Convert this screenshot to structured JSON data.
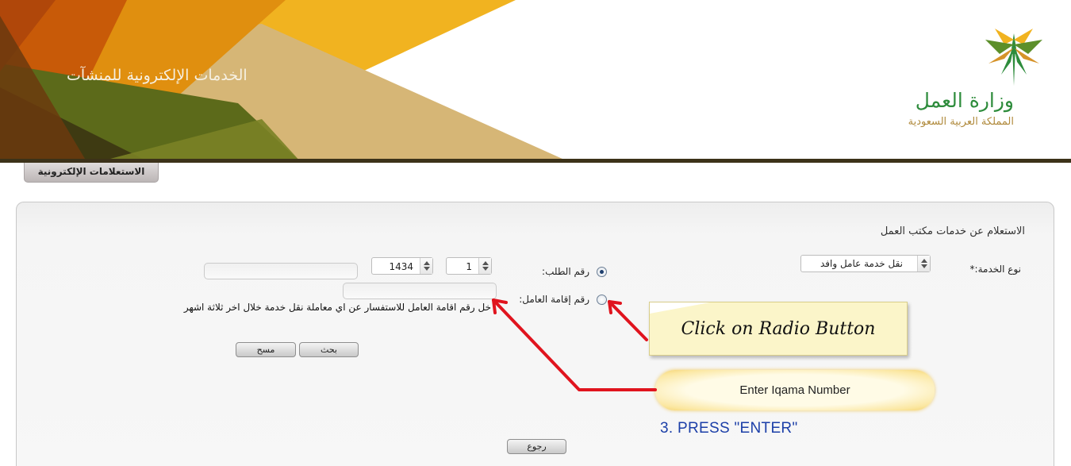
{
  "banner": {
    "title": "الخدمات الإلكترونية للمنشآت",
    "brand_name": "وزارة العمل",
    "brand_country": "المملكة العربية السعودية"
  },
  "tabs": {
    "inquiries": "الاستعلامات الإلكترونية"
  },
  "panel": {
    "title": "الاستعلام عن خدمات مكتب العمل",
    "service_type_label": "نوع الخدمة:*",
    "service_type_value": "نقل خدمة عامل وافد",
    "request_number_label": "رقم الطلب:",
    "iqama_number_label": "رقم إقامة العامل:",
    "request_year": "1434",
    "request_month": "1",
    "hint_text": "خل رقم اقامة العامل للاستفسار عن اي معاملة نقل خدمة خلال اخر ثلاثة اشهر",
    "search_button": "بحث",
    "clear_button": "مسح",
    "back_button": "رجوع",
    "selected_option": "request_number"
  },
  "annotations": {
    "callout": "Click on Radio Button",
    "pill": "Enter Iqama Number",
    "step": "3. PRESS \"ENTER\""
  },
  "colors": {
    "brand_green": "#2e8c3c",
    "brand_gold": "#b08a3c",
    "annotation_arrow": "#e0141e",
    "step_blue": "#1c3fa8"
  },
  "icons": [
    "palm-logo-icon",
    "spinner-arrows-icon",
    "arrow-icon"
  ]
}
